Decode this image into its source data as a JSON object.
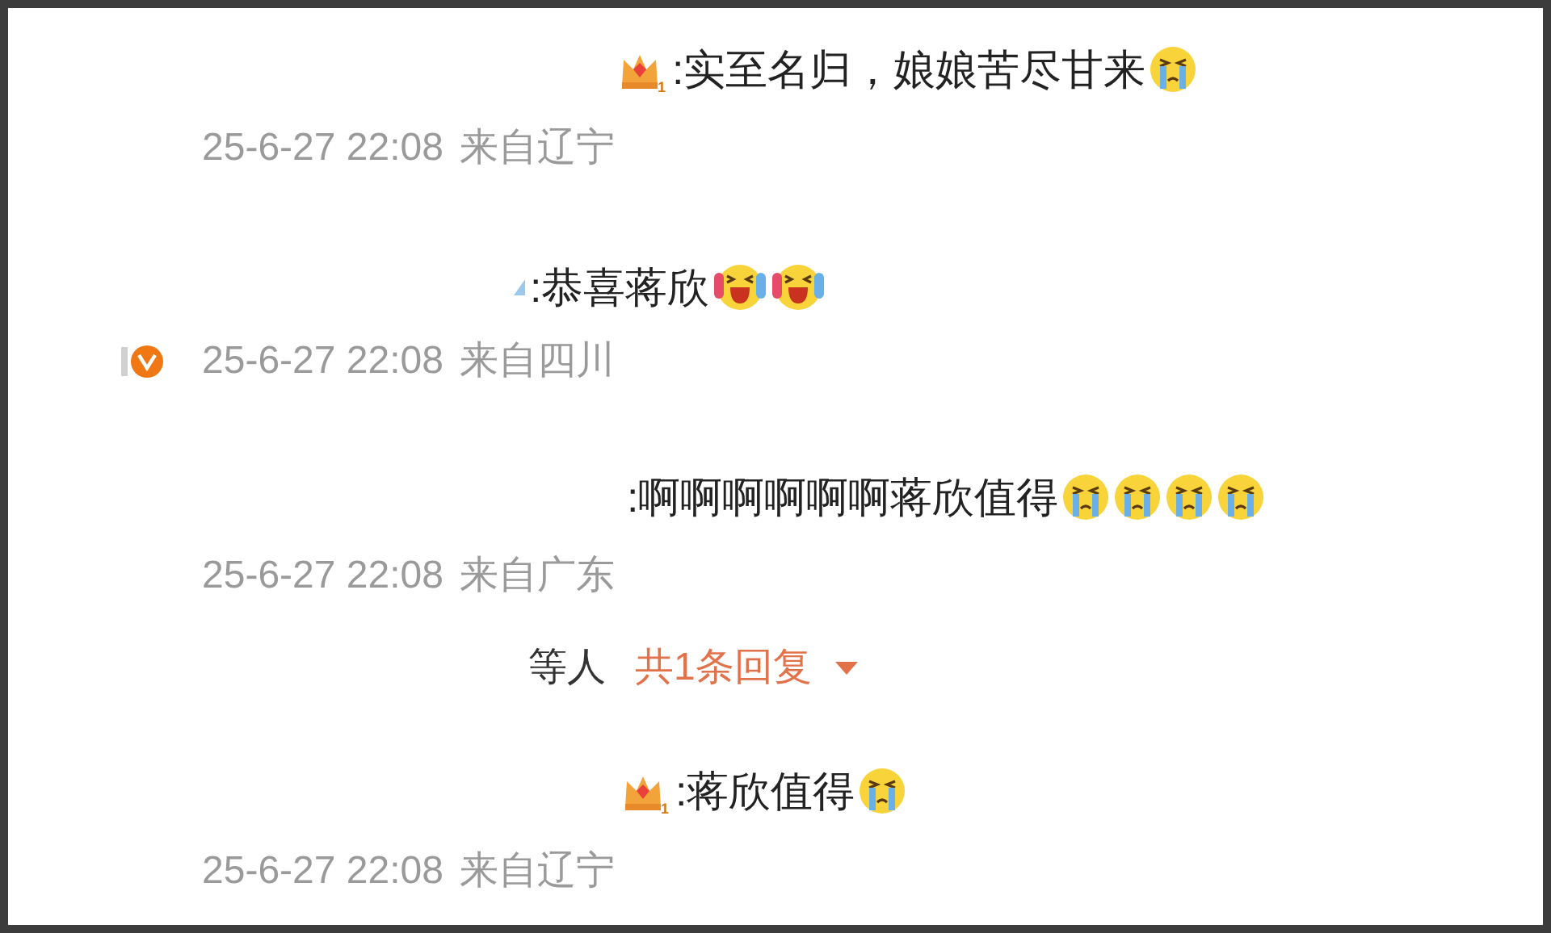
{
  "comments": [
    {
      "badge": {
        "kind": "crown",
        "level_text": "1"
      },
      "text": ":实至名归，娘娘苦尽甘来",
      "emojis": [
        {
          "kind": "cry"
        }
      ],
      "time": "25-6-27 22:08",
      "location": "来自辽宁",
      "verified": false
    },
    {
      "badge": {
        "kind": "blue-mark"
      },
      "text": ":恭喜蒋欣",
      "emojis": [
        {
          "kind": "laugh-cry"
        },
        {
          "kind": "laugh-cry"
        }
      ],
      "time": "25-6-27 22:08",
      "location": "来自四川",
      "verified": true
    },
    {
      "text": ":啊啊啊啊啊啊蒋欣值得",
      "emojis": [
        {
          "kind": "cry"
        },
        {
          "kind": "cry"
        },
        {
          "kind": "cry"
        },
        {
          "kind": "cry"
        }
      ],
      "time": "25-6-27 22:08",
      "location": "来自广东",
      "verified": false,
      "reply_bar": {
        "prefix": "等人",
        "link": "共1条回复"
      }
    },
    {
      "badge": {
        "kind": "crown",
        "level_text": "1"
      },
      "text": ":蒋欣值得",
      "emojis": [
        {
          "kind": "cry"
        }
      ],
      "time": "25-6-27 22:08",
      "location": "来自辽宁",
      "verified": false
    }
  ]
}
